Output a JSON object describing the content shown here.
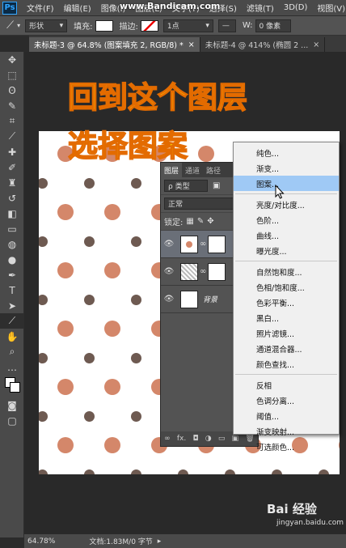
{
  "menubar": {
    "logo": "Ps",
    "items": [
      "文件(F)",
      "编辑(E)",
      "图像(I)",
      "图层(L)",
      "文字(Y)",
      "选择(S)",
      "滤镜(T)",
      "3D(D)",
      "视图(V)"
    ],
    "watermark": "www.Bandicam.com"
  },
  "options": {
    "mode": "形状",
    "fill_label": "填充:",
    "stroke_label": "描边:",
    "stroke_size": "1点",
    "w_label": "W:",
    "w_value": "0 像素"
  },
  "tabs": [
    {
      "label": "未标题-3 @ 64.8% (图案填充 2, RGB/8) *",
      "close": "×",
      "active": true
    },
    {
      "label": "未标题-4 @ 414% (椭圆 2 ...",
      "close": "×",
      "active": false
    }
  ],
  "headline": {
    "line1": "回到这个图层",
    "line2": "选择图案",
    "color": "#ffe600"
  },
  "layers_panel": {
    "tabs": [
      "图层",
      "通道",
      "路径"
    ],
    "kind_label": "ρ 类型",
    "blend_mode": "正常",
    "lock_label": "锁定:",
    "background_layer": "背景",
    "footer": [
      "∞",
      "fx.",
      "◘",
      "◑",
      "▭",
      "▣",
      "🗑"
    ]
  },
  "dropdown": {
    "group1": [
      "纯色...",
      "渐变...",
      "图案..."
    ],
    "group2": [
      "亮度/对比度...",
      "色阶...",
      "曲线...",
      "曝光度..."
    ],
    "group3": [
      "自然饱和度...",
      "色相/饱和度...",
      "色彩平衡...",
      "黑白...",
      "照片滤镜...",
      "通道混合器...",
      "颜色查找..."
    ],
    "group4": [
      "反相",
      "色调分离...",
      "阈值...",
      "渐变映射...",
      "可选颜色..."
    ],
    "highlighted": "图案..."
  },
  "status": {
    "zoom": "64.78%",
    "doc": "文档:1.83M/0 字节"
  },
  "baidu": {
    "logo": "Bai 经验",
    "url": "jingyan.baidu.com"
  },
  "colors": {
    "dot_orange": "#d4876a",
    "dot_brown": "#6e5a51"
  }
}
